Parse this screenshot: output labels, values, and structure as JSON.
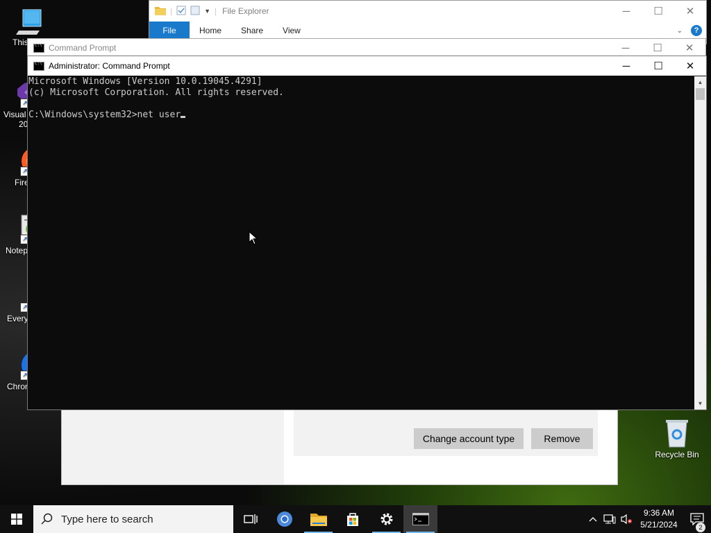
{
  "desktop": {
    "icons": [
      {
        "label": "This",
        "icon": "computer-icon"
      },
      {
        "label": "Visual",
        "label2": "20",
        "icon": "visual-studio-icon"
      },
      {
        "label": "Fire",
        "icon": "firefox-icon"
      },
      {
        "label": "Notep",
        "icon": "notepad-icon"
      },
      {
        "label": "Every",
        "icon": "everything-icon"
      },
      {
        "label": "Chron",
        "icon": "chrome-icon"
      }
    ],
    "recycle_bin": {
      "label": "Recycle Bin",
      "icon": "recycle-bin-icon"
    }
  },
  "file_explorer": {
    "title": "File Explorer",
    "tabs": [
      "File",
      "Home",
      "Share",
      "View"
    ],
    "help": "?"
  },
  "cmd_back": {
    "title": "Command Prompt"
  },
  "cmd": {
    "title": "Administrator: Command Prompt",
    "lines": [
      "Microsoft Windows [Version 10.0.19045.4291]",
      "(c) Microsoft Corporation. All rights reserved.",
      "",
      "C:\\Windows\\system32>net user"
    ]
  },
  "settings_window": {
    "buttons": [
      "Change account type",
      "Remove"
    ]
  },
  "taskbar": {
    "search_placeholder": "Type here to search",
    "apps": [
      "task-view-icon",
      "chrome-icon",
      "file-explorer-icon",
      "store-icon",
      "settings-icon",
      "command-prompt-icon"
    ],
    "time": "9:36 AM",
    "date": "5/21/2024",
    "notification_count": "2"
  },
  "colors": {
    "accent": "#1979ca",
    "console_bg": "#0c0c0c",
    "console_fg": "#cccccc",
    "taskbar_bg": "#101010"
  }
}
